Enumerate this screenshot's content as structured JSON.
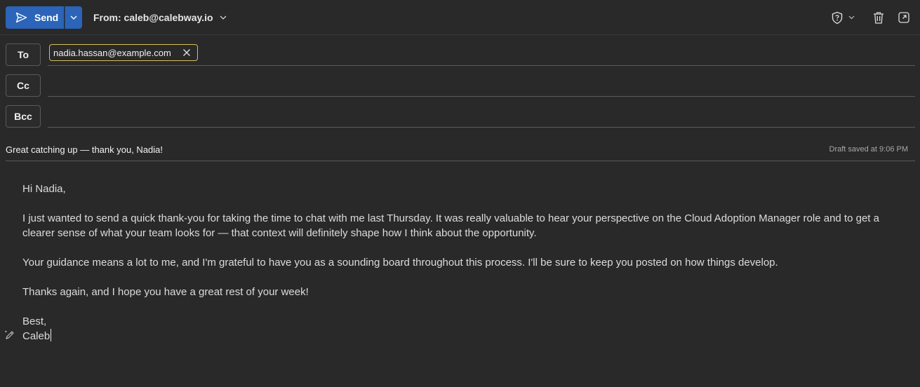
{
  "toolbar": {
    "send_label": "Send",
    "from_label": "From: caleb@calebway.io",
    "icons": [
      "send-icon",
      "chevron-down-icon",
      "shield-question-icon",
      "trash-icon",
      "pop-out-icon"
    ]
  },
  "recipients": {
    "to_label": "To",
    "cc_label": "Cc",
    "bcc_label": "Bcc",
    "to_chips": [
      {
        "address": "nadia.hassan@example.com"
      }
    ]
  },
  "subject": {
    "text": "Great catching up — thank you, Nadia!",
    "draft_status": "Draft saved at 9:06 PM"
  },
  "body": {
    "greeting": "Hi Nadia,",
    "paragraphs": [
      "I just wanted to send a quick thank-you for taking the time to chat with me last Thursday. It was really valuable to hear your perspective on the Cloud Adoption Manager role and to get a clearer sense of what your team looks for — that context will definitely shape how I think about the opportunity.",
      "Your guidance means a lot to me, and I'm grateful to have you as a sounding board throughout this process. I'll be sure to keep you posted on how things develop.",
      "Thanks again, and I hope you have a great rest of your week!"
    ],
    "signoff": "Best,",
    "signature": "Caleb"
  },
  "colors": {
    "background": "#292929",
    "accent": "#2b64b8",
    "chip_border": "#d6c15a"
  }
}
